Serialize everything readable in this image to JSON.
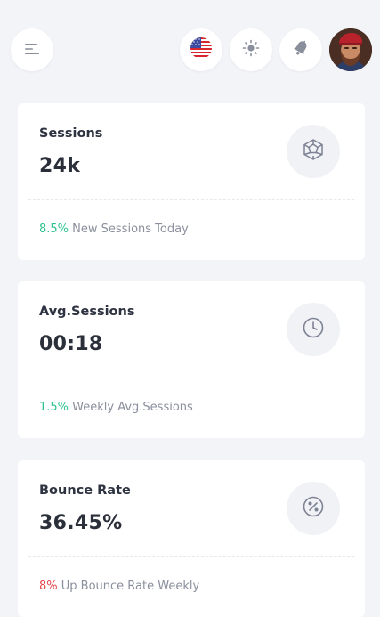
{
  "header": {
    "menu_icon": "menu-icon",
    "language_flag": "us-flag-icon",
    "theme_icon": "sun-icon",
    "notification_icon": "bell-icon",
    "avatar": "user-avatar"
  },
  "cards": [
    {
      "title": "Sessions",
      "value": "24k",
      "icon": "dodecahedron-icon",
      "change": "8.5%",
      "change_color": "#2ec18f",
      "caption": "New Sessions Today"
    },
    {
      "title": "Avg.Sessions",
      "value": "00:18",
      "icon": "clock-icon",
      "change": "1.5%",
      "change_color": "#2ec18f",
      "caption": "Weekly Avg.Sessions"
    },
    {
      "title": "Bounce Rate",
      "value": "36.45%",
      "icon": "percent-icon",
      "change": "8%",
      "change_color": "#e5484d",
      "caption": "Up Bounce Rate Weekly"
    }
  ]
}
